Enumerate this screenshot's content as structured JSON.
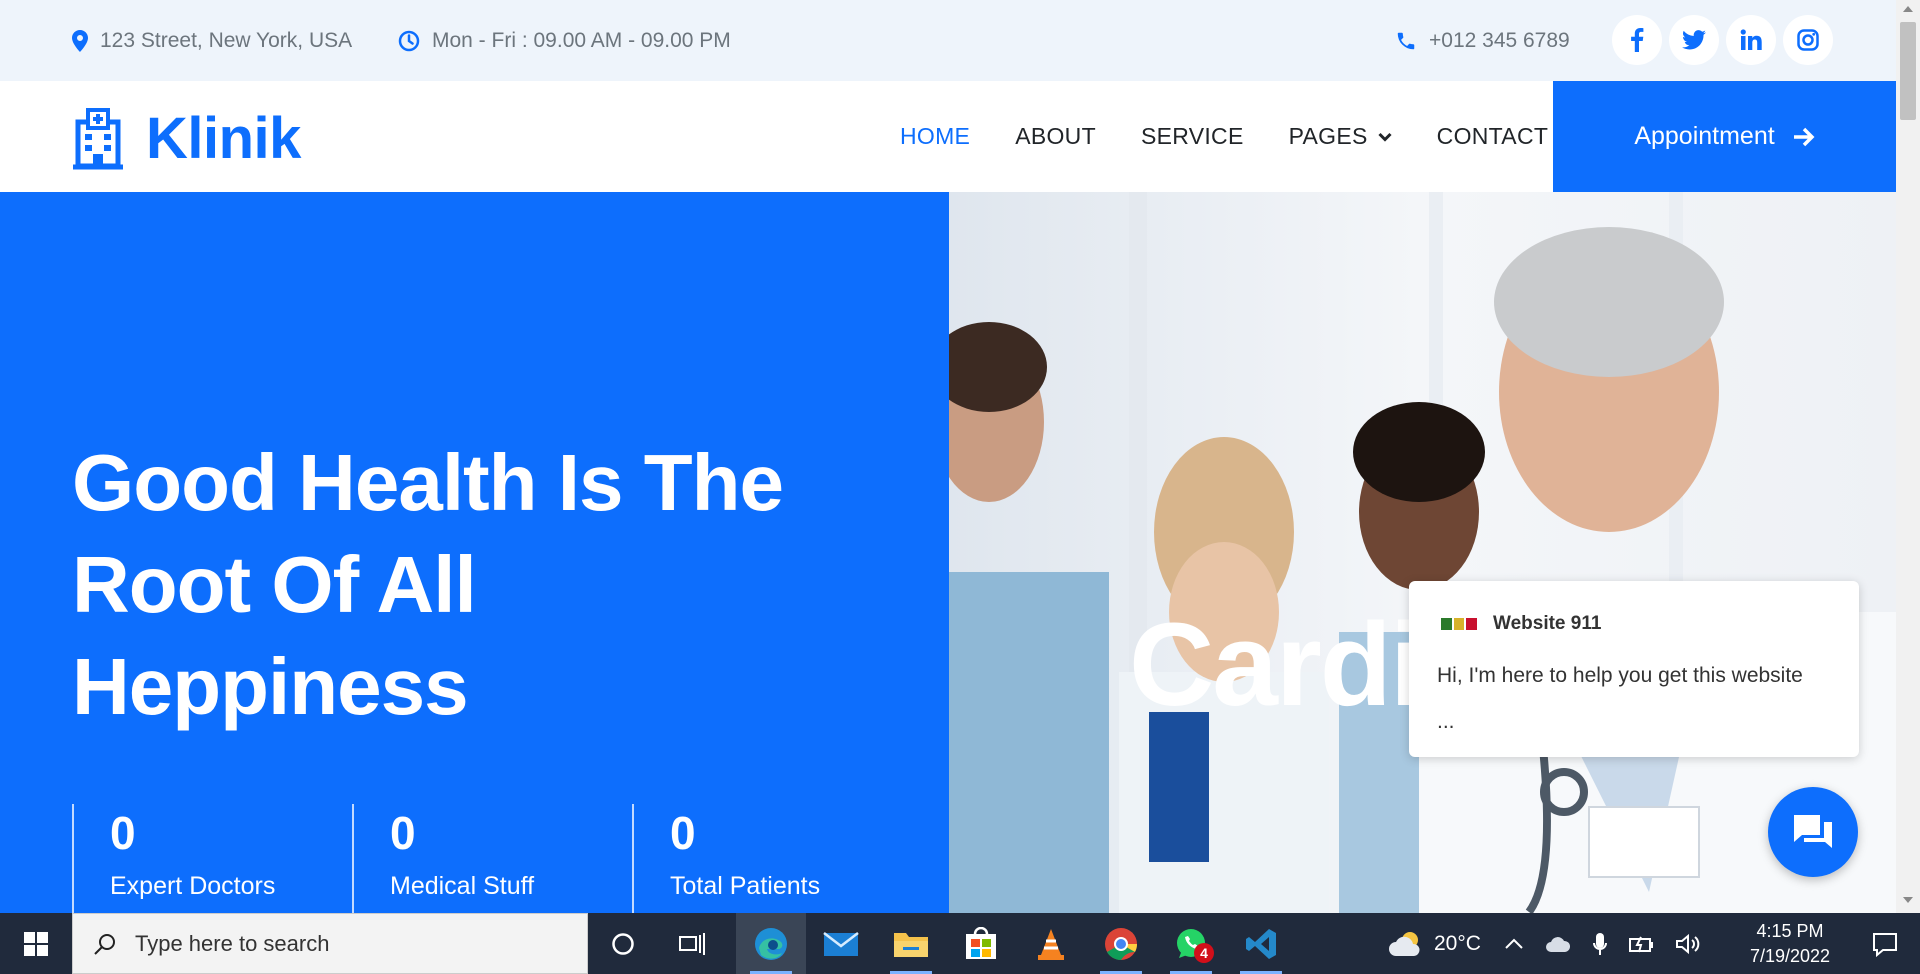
{
  "topbar": {
    "address": "123 Street, New York, USA",
    "hours": "Mon - Fri : 09.00 AM - 09.00 PM",
    "phone": "+012 345 6789",
    "socials": [
      {
        "icon": "facebook-icon",
        "glyph": "f"
      },
      {
        "icon": "twitter-icon",
        "glyph": "t"
      },
      {
        "icon": "linkedin-icon",
        "glyph": "in"
      },
      {
        "icon": "instagram-icon",
        "glyph": "ig"
      }
    ]
  },
  "navbar": {
    "brand": "Klinik",
    "links": [
      "HOME",
      "ABOUT",
      "SERVICE",
      "PAGES",
      "CONTACT"
    ],
    "active": "HOME",
    "appointment_label": "Appointment"
  },
  "hero": {
    "title_lines": [
      "Good Health Is The",
      "Root Of All",
      "Heppiness"
    ],
    "carousel_word": "Cardi",
    "stats": [
      {
        "value": "0",
        "label": "Expert Doctors"
      },
      {
        "value": "0",
        "label": "Medical Stuff"
      },
      {
        "value": "0",
        "label": "Total Patients"
      }
    ]
  },
  "chat": {
    "name": "Website 911",
    "message": "Hi, I'm here to help you get this website",
    "ellipsis": "..."
  },
  "taskbar": {
    "search_placeholder": "Type here to search",
    "temperature": "20°C",
    "time": "4:15 PM",
    "date": "7/19/2022",
    "whatsapp_badge": "4"
  },
  "colors": {
    "primary": "#0d6efd",
    "topbar_bg": "#eef4fb",
    "taskbar_bg": "#202a3c"
  }
}
